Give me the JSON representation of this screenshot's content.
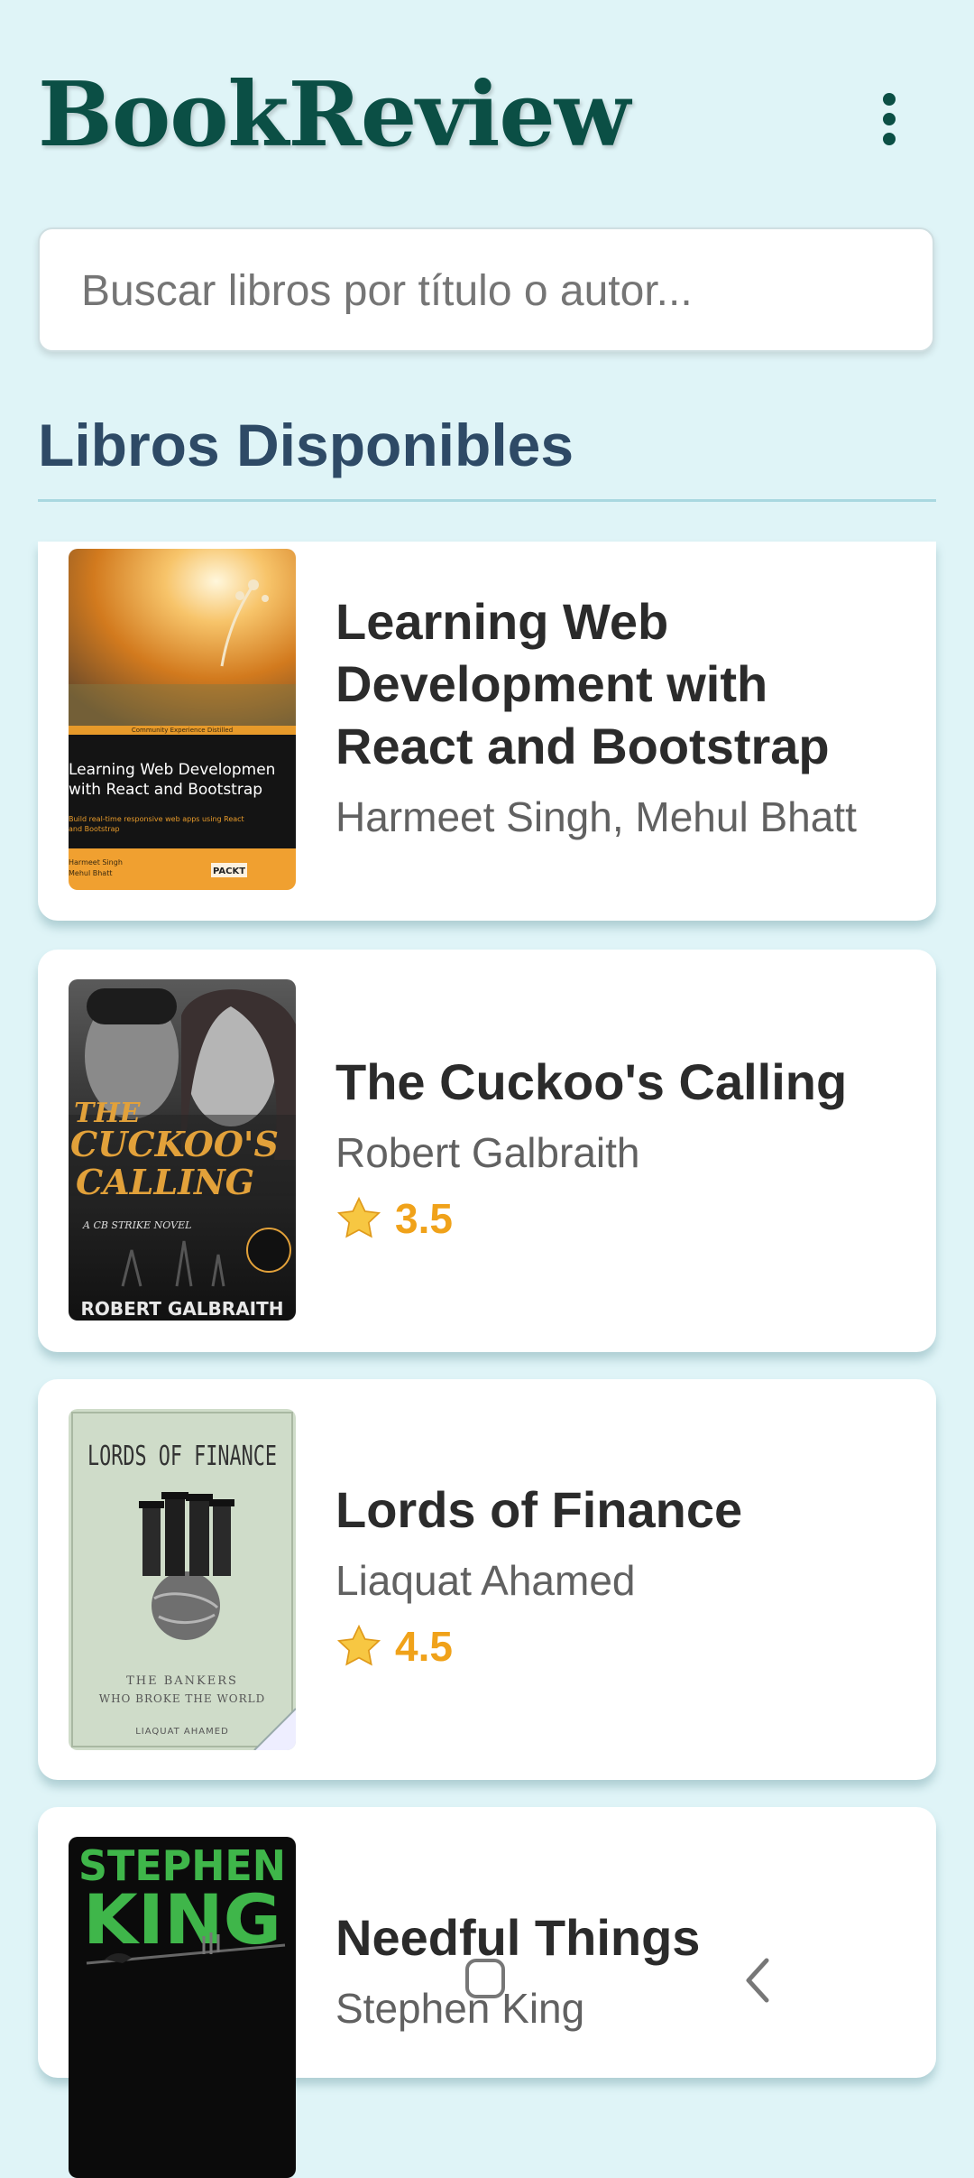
{
  "header": {
    "title": "BookReview",
    "menu_icon": "more-vertical-icon"
  },
  "search": {
    "placeholder": "Buscar libros por título o autor..."
  },
  "section": {
    "title": "Libros Disponibles"
  },
  "colors": {
    "primary": "#0b4f45",
    "background": "#dff4f7",
    "rating": "#f0a21a",
    "section_title": "#2e4a66"
  },
  "books": [
    {
      "title": "Learning Web Development with React and Bootstrap",
      "author": "Harmeet Singh, Mehul Bhatt",
      "cover": {
        "series_text": "Community Experience Distilled",
        "title_line1": "Learning Web Developmen",
        "title_line2": "with React and Bootstrap",
        "subtitle_line1": "Build real-time responsive web apps using React",
        "subtitle_line2": "and Bootstrap",
        "author_line1": "Harmeet Singh",
        "author_line2": "Mehul Bhatt",
        "publisher": "PACKT"
      }
    },
    {
      "title": "The Cuckoo's Calling",
      "author": "Robert Galbraith",
      "rating": "3.5",
      "cover": {
        "title_line1": "THE",
        "title_line2": "CUCKOO'S",
        "title_line3": "CALLING",
        "series": "A CB STRIKE NOVEL",
        "author": "ROBERT GALBRAITH"
      }
    },
    {
      "title": "Lords of Finance",
      "author": "Liaquat Ahamed",
      "rating": "4.5",
      "cover": {
        "title": "LORDS OF FINANCE",
        "subtitle_line1": "THE BANKERS",
        "subtitle_line2": "WHO BROKE THE WORLD",
        "author": "LIAQUAT AHAMED"
      }
    },
    {
      "title": "Needful Things",
      "author": "Stephen King",
      "cover": {
        "author_line1": "STEPHEN",
        "author_line2": "KING"
      }
    }
  ],
  "nav": {
    "home_icon": "home-icon",
    "back_icon": "back-icon"
  }
}
